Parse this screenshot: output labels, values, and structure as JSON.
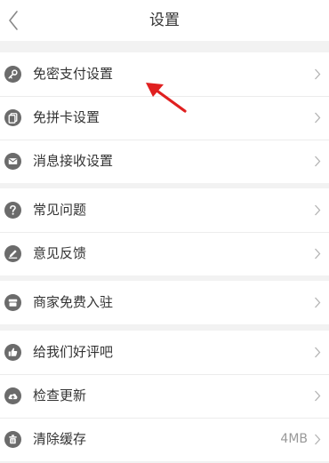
{
  "nav": {
    "title": "设置",
    "back_icon": "chevron-left-icon"
  },
  "groups": [
    {
      "items": [
        {
          "label": "免密支付设置",
          "icon": "key-icon"
        },
        {
          "label": "免拼卡设置",
          "icon": "card-icon"
        },
        {
          "label": "消息接收设置",
          "icon": "envelope-icon"
        }
      ]
    },
    {
      "items": [
        {
          "label": "常见问题",
          "icon": "question-icon"
        },
        {
          "label": "意见反馈",
          "icon": "pencil-icon"
        }
      ]
    },
    {
      "items": [
        {
          "label": "商家免费入驻",
          "icon": "store-icon"
        }
      ]
    },
    {
      "items": [
        {
          "label": "给我们好评吧",
          "icon": "thumbs-up-icon"
        },
        {
          "label": "检查更新",
          "icon": "cloud-upload-icon"
        },
        {
          "label": "清除缓存",
          "icon": "trash-icon",
          "value": "4MB"
        }
      ]
    }
  ],
  "colors": {
    "icon": "#6b6b6b",
    "annotation_arrow": "#e02020"
  }
}
